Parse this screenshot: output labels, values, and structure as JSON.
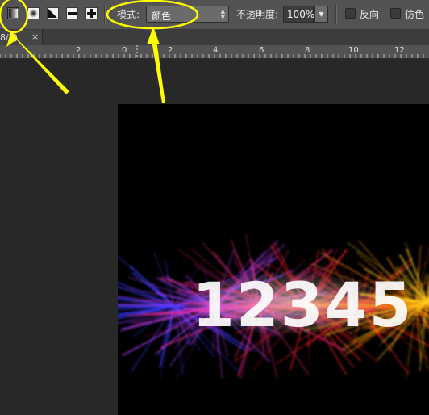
{
  "options_bar": {
    "gradient_types": [
      {
        "icon": "linear-gradient-icon",
        "active": true
      },
      {
        "icon": "radial-gradient-icon",
        "active": false
      },
      {
        "icon": "angle-gradient-icon",
        "active": false
      },
      {
        "icon": "reflected-gradient-icon",
        "active": false
      },
      {
        "icon": "diamond-gradient-icon",
        "active": false
      }
    ],
    "mode_label": "模式:",
    "mode_value": "颜色",
    "opacity_label": "不透明度:",
    "opacity_value": "100%",
    "reverse_label": "反向",
    "dither_label": "仿色"
  },
  "document_tab": {
    "title": "8/8)",
    "close": "×"
  },
  "ruler": {
    "labels": [
      "2",
      "0",
      "2",
      "4",
      "6",
      "8",
      "10",
      "12"
    ]
  },
  "canvas": {
    "artwork_text": "12345",
    "colors": [
      "#3a3aff",
      "#b040ff",
      "#ff2a8a",
      "#ff2020",
      "#ff8a00",
      "#ffd020"
    ]
  },
  "annotations": {
    "color": "#ffff00"
  }
}
